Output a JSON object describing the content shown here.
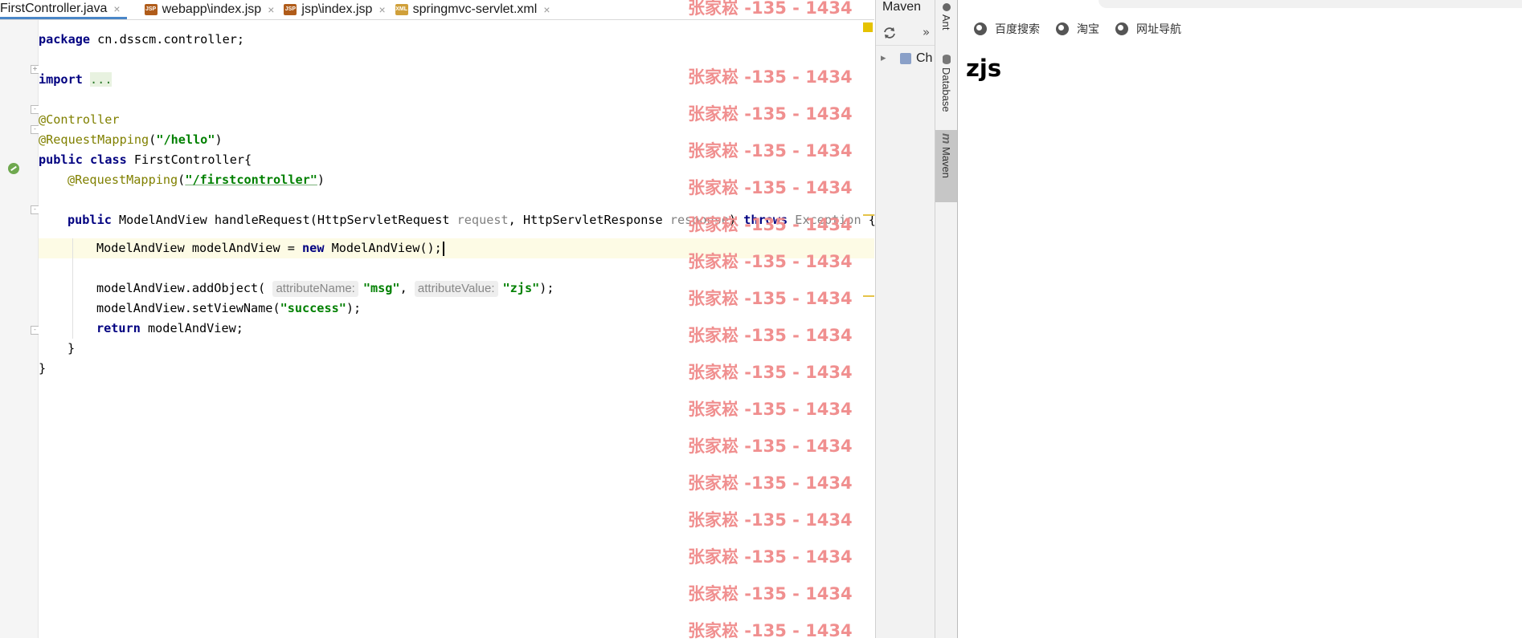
{
  "tabs": [
    {
      "label": "FirstController.java",
      "icon": "java-class-icon",
      "active": true
    },
    {
      "label": "webapp\\index.jsp",
      "icon": "jsp-file-icon",
      "active": false
    },
    {
      "label": "jsp\\index.jsp",
      "icon": "jsp-file-icon",
      "active": false
    },
    {
      "label": "springmvc-servlet.xml",
      "icon": "xml-file-icon",
      "active": false
    }
  ],
  "tab_close_glyph": "×",
  "code": {
    "l1": {
      "kw": "package",
      "rest": " cn.dsscm.controller;"
    },
    "l3": {
      "kw": "import",
      "fold": "..."
    },
    "l5": {
      "ann": "@Controller"
    },
    "l6": {
      "ann": "@RequestMapping",
      "open": "(",
      "str": "\"/hello\"",
      "close": ")"
    },
    "l7": {
      "kw1": "public",
      "kw2": "class",
      "rest": " FirstController{"
    },
    "l8": {
      "ann": "@RequestMapping",
      "open": "(",
      "str": "\"/firstcontroller\"",
      "close": ")"
    },
    "l10": {
      "kw": "public",
      "rest1": " ModelAndView handleRequest(HttpServletRequest ",
      "p1": "request",
      "rest2": ", HttpServletResponse ",
      "p2": "response",
      "rest3": ") ",
      "kw2": "throws",
      "p3": " Exception",
      "rest4": " {"
    },
    "l11": {
      "a": "ModelAndView modelAndView = ",
      "kw": "new",
      "b": " ModelAndView();"
    },
    "l13": {
      "a": "modelAndView.addObject(",
      "h1": "attributeName:",
      "s1": "\"msg\"",
      "comma": ",",
      "h2": "attributeValue:",
      "s2": "\"zjs\"",
      "end": ");"
    },
    "l14": {
      "a": "modelAndView.setViewName(",
      "s": "\"success\"",
      "end": ");"
    },
    "l15": {
      "kw": "return",
      "rest": " modelAndView;"
    },
    "l16": {
      "t": "}"
    },
    "l17": {
      "t": "}"
    }
  },
  "watermark": "张家崧 -135 - 1434",
  "maven": {
    "title": "Maven",
    "more": "»",
    "tree_item": "Ch"
  },
  "side_tabs": {
    "ant": "Ant",
    "database": "Database",
    "maven": "Maven"
  },
  "browser": {
    "bookmarks": [
      {
        "label": "百度搜索",
        "icon": "globe-icon"
      },
      {
        "label": "淘宝",
        "icon": "globe-icon"
      },
      {
        "label": "网址导航",
        "icon": "globe-icon"
      }
    ],
    "page_heading": "zjs"
  },
  "colors": {
    "watermark": "#f08f8f",
    "keyword": "#000080",
    "annotation": "#808000",
    "string": "#008000",
    "caret_line": "#fdfbe5"
  }
}
